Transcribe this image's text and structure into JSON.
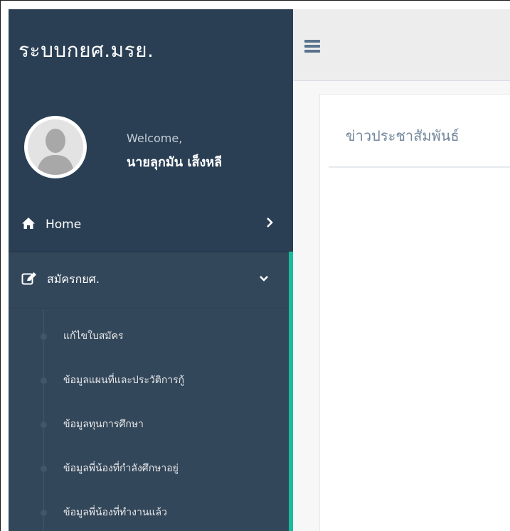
{
  "brand": {
    "title": "ระบบกยศ.มรย."
  },
  "profile": {
    "welcome": "Welcome,",
    "username": "นายลุกมัน เส็งหลี",
    "avatar_icon": "user-silhouette-icon"
  },
  "nav": {
    "home": {
      "label": "Home",
      "icon": "home-icon",
      "chevron": "chevron-right-icon"
    },
    "apply": {
      "label": "สมัครกยศ.",
      "icon": "edit-icon",
      "chevron": "chevron-down-icon",
      "items": [
        {
          "label": "แก้ไขใบสมัคร"
        },
        {
          "label": "ข้อมูลแผนที่และประวัติการกู้"
        },
        {
          "label": "ข้อมูลทุนการศึกษา"
        },
        {
          "label": "ข้อมูลพี่น้องที่กำลังศึกษาอยู่"
        },
        {
          "label": "ข้อมูลพี่น้องที่ทำงานแล้ว"
        }
      ]
    }
  },
  "topnav": {
    "menu_toggle_icon": "hamburger-icon"
  },
  "main": {
    "panel_title": "ข่าวประชาสัมพันธ์"
  },
  "colors": {
    "sidebar": "#2a3f54",
    "accent": "#1abb9c",
    "topnav": "#ededed",
    "title_text": "#73879c"
  }
}
